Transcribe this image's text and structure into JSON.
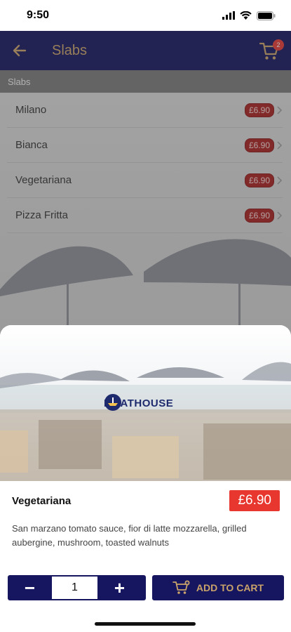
{
  "status_bar": {
    "time": "9:50"
  },
  "nav": {
    "title": "Slabs",
    "cart_count": "2"
  },
  "category": {
    "label": "Slabs"
  },
  "menu_items": [
    {
      "name": "Milano",
      "price": "£6.90"
    },
    {
      "name": "Bianca",
      "price": "£6.90"
    },
    {
      "name": "Vegetariana",
      "price": "£6.90"
    },
    {
      "name": "Pizza Fritta",
      "price": "£6.90"
    }
  ],
  "detail": {
    "logo_text": "BOATHOUSE",
    "title": "Vegetariana",
    "price": "£6.90",
    "description": "San marzano tomato sauce, fior di latte mozzarella, grilled aubergine, mushroom, toasted walnuts",
    "quantity": "1",
    "minus_label": "−",
    "plus_label": "+",
    "add_to_cart_label": "ADD TO CART"
  },
  "colors": {
    "nav_bg": "#151560",
    "accent_gold": "#c9a36a",
    "price_red": "#e8372f"
  },
  "icons": {
    "back": "arrow-left-icon",
    "cart": "cart-icon",
    "chevron": "chevron-right-icon",
    "add_to_cart": "cart-plus-icon"
  }
}
